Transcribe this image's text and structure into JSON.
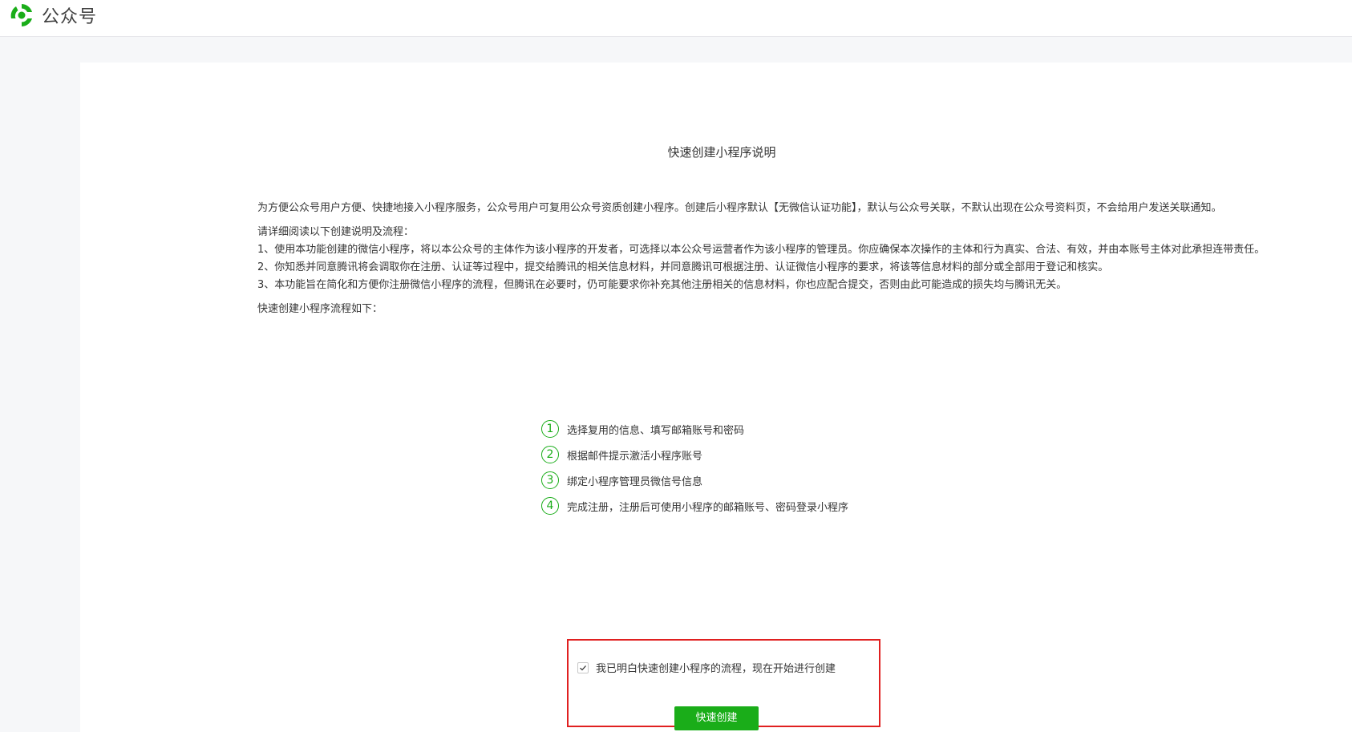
{
  "header": {
    "logo_text": "公众号",
    "logo_icon": "wechat-official-account-logo-icon",
    "accent_color": "#1aad19"
  },
  "content": {
    "title": "快速创建小程序说明",
    "intro": "为方便公众号用户方便、快捷地接入小程序服务，公众号用户可复用公众号资质创建小程序。创建后小程序默认【无微信认证功能】，默认与公众号关联，不默认出现在公众号资料页，不会给用户发送关联通知。",
    "read_prompt": "请详细阅读以下创建说明及流程：",
    "notes": [
      "1、使用本功能创建的微信小程序，将以本公众号的主体作为该小程序的开发者，可选择以本公众号运营者作为该小程序的管理员。你应确保本次操作的主体和行为真实、合法、有效，并由本账号主体对此承担连带责任。",
      "2、你知悉并同意腾讯将会调取你在注册、认证等过程中，提交给腾讯的相关信息材料，并同意腾讯可根据注册、认证微信小程序的要求，将该等信息材料的部分或全部用于登记和核实。",
      "3、本功能旨在简化和方便你注册微信小程序的流程，但腾讯在必要时，仍可能要求你补充其他注册相关的信息材料，你也应配合提交，否则由此可能造成的损失均与腾讯无关。"
    ],
    "flow_label": "快速创建小程序流程如下："
  },
  "steps": [
    {
      "num": "1",
      "text": "选择复用的信息、填写邮箱账号和密码"
    },
    {
      "num": "2",
      "text": "根据邮件提示激活小程序账号"
    },
    {
      "num": "3",
      "text": "绑定小程序管理员微信号信息"
    },
    {
      "num": "4",
      "text": "完成注册，注册后可使用小程序的邮箱账号、密码登录小程序"
    }
  ],
  "agreement": {
    "checked": true,
    "text": "我已明白快速创建小程序的流程，现在开始进行创建",
    "highlight_color": "#e02020"
  },
  "actions": {
    "create_label": "快速创建"
  }
}
